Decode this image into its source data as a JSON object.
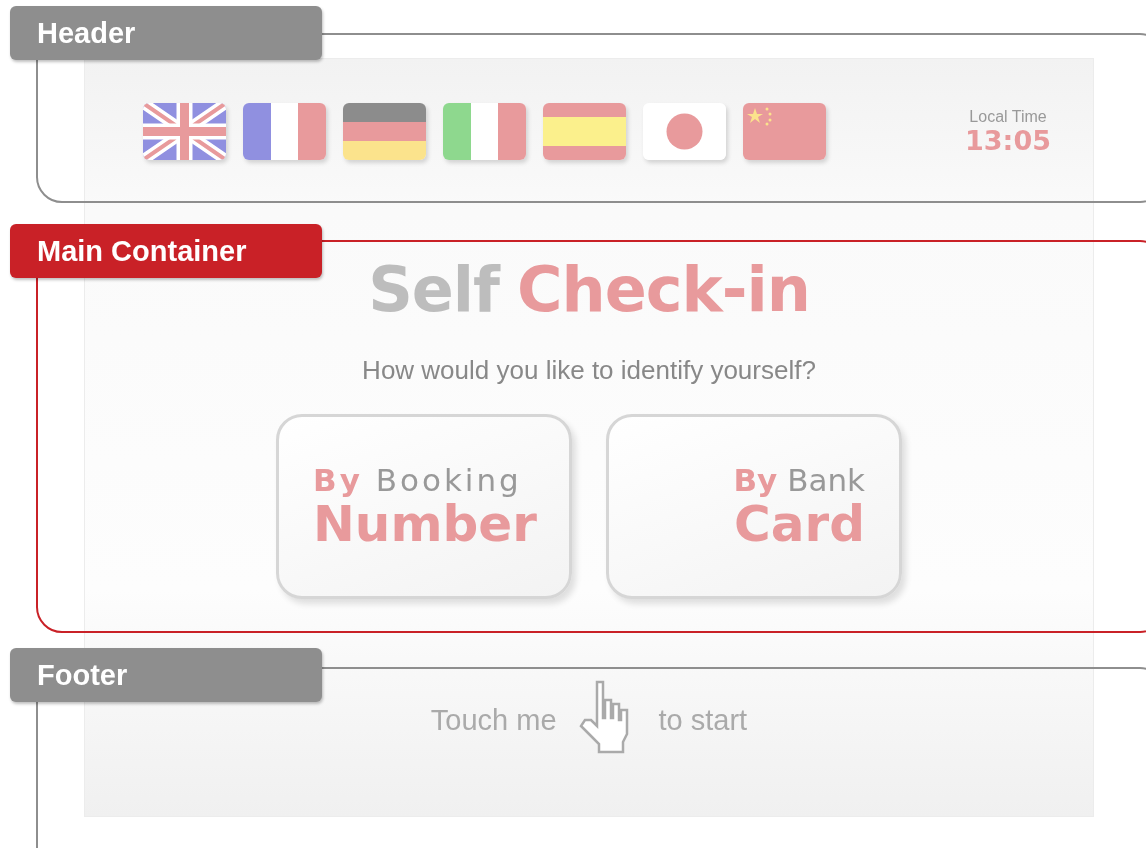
{
  "annotations": [
    {
      "label": "Header",
      "color": "#8e8e8e"
    },
    {
      "label": "Main Container",
      "color": "#c92127"
    },
    {
      "label": "Footer",
      "color": "#8e8e8e"
    }
  ],
  "header": {
    "languages": [
      {
        "kind": "uk"
      },
      {
        "kind": "fr"
      },
      {
        "kind": "de"
      },
      {
        "kind": "it"
      },
      {
        "kind": "es"
      },
      {
        "kind": "jp"
      },
      {
        "kind": "cn"
      }
    ],
    "clock": {
      "label": "Local Time",
      "time": "13:05"
    }
  },
  "main": {
    "title": {
      "first": "Self",
      "second": "Check-in"
    },
    "question": "How would you like to identify yourself?",
    "options": [
      {
        "prefix": "By",
        "word": "Booking",
        "main": "Number",
        "kind": "left"
      },
      {
        "prefix": "By",
        "word": "Bank",
        "main": "Card",
        "kind": "right"
      }
    ]
  },
  "footer": {
    "before": "Touch me",
    "after": "to start"
  }
}
